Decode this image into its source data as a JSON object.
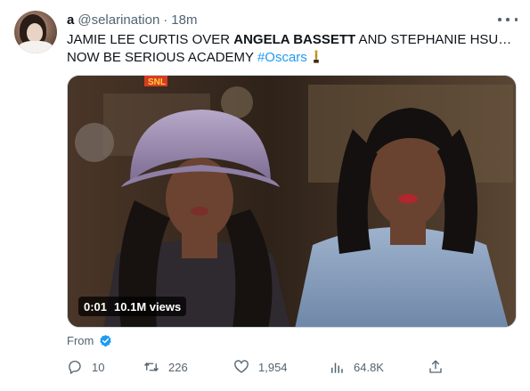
{
  "tweet": {
    "author": {
      "display_name": "a",
      "handle": "@selarination",
      "separator": "·",
      "timestamp": "18m"
    },
    "text": {
      "part1": "JAMIE LEE CURTIS OVER ",
      "bold1": "ANGELA BASSETT",
      "part2": " AND STEPHANIE HSU…",
      "part3": "NOW BE SERIOUS ACADEMY ",
      "hashtag": "#Oscars",
      "trailing_emoji": "trophy-icon"
    },
    "media": {
      "type": "video",
      "elapsed": "0:01",
      "views": "10.1M views",
      "logo_text": "SNL"
    },
    "from_label": "From",
    "stats": {
      "replies": "10",
      "retweets": "226",
      "likes": "1,954",
      "views": "64.8K"
    }
  },
  "colors": {
    "accent": "#1d9bf0",
    "secondary_text": "#536471",
    "primary_text": "#0f1419"
  }
}
